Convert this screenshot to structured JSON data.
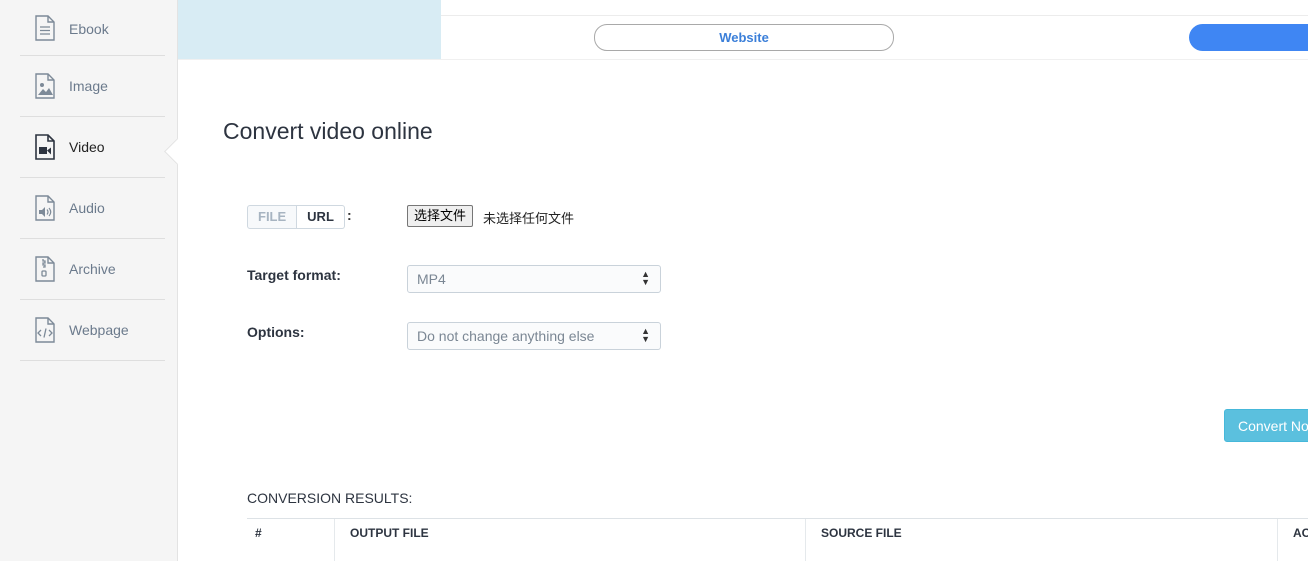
{
  "sidebar": {
    "items": [
      {
        "label": "Ebook",
        "icon": "ebook-icon"
      },
      {
        "label": "Image",
        "icon": "image-icon"
      },
      {
        "label": "Video",
        "icon": "video-icon",
        "active": true
      },
      {
        "label": "Audio",
        "icon": "audio-icon"
      },
      {
        "label": "Archive",
        "icon": "archive-icon"
      },
      {
        "label": "Webpage",
        "icon": "webpage-icon"
      }
    ]
  },
  "topbar": {
    "website_label": "Website",
    "accent_color": "#3f86f3"
  },
  "main": {
    "title": "Convert video online",
    "source_tabs": {
      "file": "FILE",
      "url": "URL",
      "colon": ":"
    },
    "file_input": {
      "button_label": "选择文件",
      "status": "未选择任何文件"
    },
    "target_format": {
      "label": "Target format:",
      "value": "MP4"
    },
    "options": {
      "label": "Options:",
      "value": "Do not change anything else"
    },
    "convert_label": "Convert Now",
    "convert_color": "#5bc0de"
  },
  "results": {
    "title": "CONVERSION RESULTS:",
    "columns": [
      "#",
      "OUTPUT FILE",
      "SOURCE FILE",
      "ACTIONS"
    ]
  }
}
